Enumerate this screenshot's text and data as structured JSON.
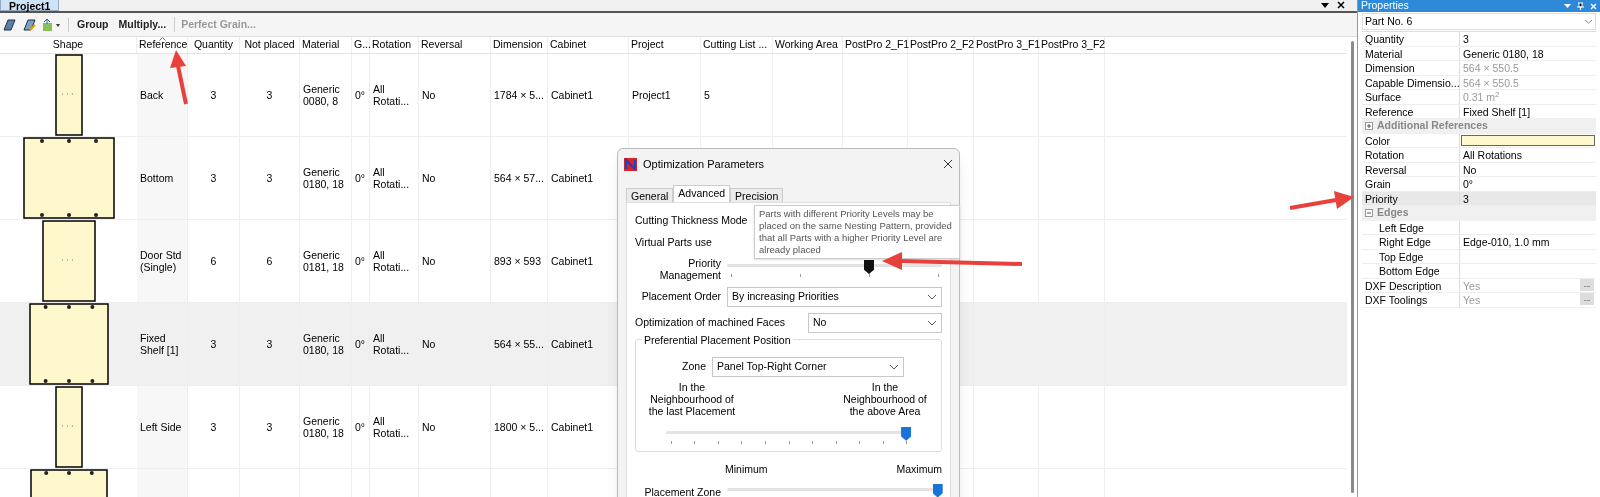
{
  "document_tab": {
    "label": "Project1",
    "selected": true
  },
  "toolbar": {
    "buttons": [
      {
        "label": "Group",
        "disabled": false
      },
      {
        "label": "Multiply...",
        "disabled": false
      },
      {
        "label": "Perfect Grain...",
        "disabled": true
      }
    ]
  },
  "table": {
    "shape_column": "Shape",
    "columns": [
      "Reference",
      "Quantity",
      "Not placed",
      "Material",
      "G...",
      "Rotation",
      "Reversal",
      "Dimension",
      "Cabinet",
      "Project",
      "Cutting List ...",
      "Working Area",
      "PostPro 2_F1",
      "PostPro 2_F2",
      "PostPro 3_F1",
      "PostPro 3_F2"
    ],
    "rows": [
      {
        "selected": false,
        "cells": [
          "Back",
          "3",
          "3",
          "Generic 0080, 8",
          "0°",
          "All Rotati...",
          "No",
          "1784 × 5...",
          "Cabinet1",
          "Project1",
          "5"
        ]
      },
      {
        "selected": false,
        "cells": [
          "Bottom",
          "3",
          "3",
          "Generic 0180, 18",
          "0°",
          "All Rotati...",
          "No",
          "564 × 57...",
          "Cabinet1"
        ]
      },
      {
        "selected": false,
        "cells": [
          "Door Std (Single)",
          "6",
          "6",
          "Generic 0181, 18",
          "0°",
          "All Rotati...",
          "No",
          "893 × 593",
          "Cabinet1"
        ]
      },
      {
        "selected": true,
        "cells": [
          "Fixed Shelf [1]",
          "3",
          "3",
          "Generic 0180, 18",
          "0°",
          "All Rotati...",
          "No",
          "564 × 55...",
          "Cabinet1"
        ]
      },
      {
        "selected": false,
        "cells": [
          "Left Side",
          "3",
          "3",
          "Generic 0180, 18",
          "0°",
          "All Rotati...",
          "No",
          "1800 × 5...",
          "Cabinet1"
        ]
      },
      {
        "selected": false
      }
    ]
  },
  "dialog": {
    "title": "Optimization Parameters",
    "tabs": [
      {
        "label": "General",
        "selected": false
      },
      {
        "label": "Advanced",
        "selected": true
      },
      {
        "label": "Precision",
        "selected": false
      }
    ],
    "labels": [
      "Cutting Thickness Mode",
      "Virtual Parts use"
    ],
    "priority": {
      "label": "Priority Management",
      "level": 0.667
    },
    "placement_order": {
      "label": "Placement Order",
      "value": "By increasing Priorities"
    },
    "machined_faces": {
      "label": "Optimization of machined Faces",
      "value": "No"
    },
    "group": {
      "title": "Preferential Placement Position",
      "zone_label": "Zone",
      "zone_value": "Panel Top-Right Corner",
      "left_label": "In the Neighbourhood of the last Placement",
      "right_label": "In the Neighbourhood of the above Area",
      "level": 1
    },
    "zone_adjust": {
      "min_label": "Minimum",
      "max_label": "Maximum",
      "label": "Placement Zone",
      "level": 1
    },
    "tooltip": "Parts with different Priority Levels may be placed on the same Nesting Pattern, provided that all Parts with a higher Priority Level are already placed"
  },
  "properties": {
    "title": "Properties",
    "selector": "Part No. 6",
    "rows": [
      {
        "kind": "row",
        "label": "Quantity",
        "value": "3",
        "dimmed": false,
        "selected": false
      },
      {
        "kind": "row",
        "label": "Material",
        "value": "Generic 0180, 18",
        "dimmed": false,
        "selected": false
      },
      {
        "kind": "row",
        "label": "Dimension",
        "value": "564 × 550.5",
        "dimmed": true,
        "selected": false
      },
      {
        "kind": "row",
        "label": "Capable Dimensio...",
        "value": "564 × 550.5",
        "dimmed": true,
        "selected": false
      },
      {
        "kind": "row",
        "label": "Surface",
        "value": "0.31 m$^{2}$",
        "dimmed": true,
        "selected": false
      },
      {
        "kind": "row",
        "label": "Reference",
        "value": "Fixed Shelf [1]",
        "dimmed": false,
        "selected": false
      },
      {
        "kind": "group",
        "label": "Additional References",
        "expanded": false,
        "children": []
      },
      {
        "kind": "color",
        "label": "Color",
        "color": "#fff8cc",
        "selected": false
      },
      {
        "kind": "row",
        "label": "Rotation",
        "value": "All Rotations",
        "dimmed": false,
        "selected": false
      },
      {
        "kind": "row",
        "label": "Reversal",
        "value": "No",
        "dimmed": false,
        "selected": false
      },
      {
        "kind": "row",
        "label": "Grain",
        "value": "0°",
        "dimmed": false,
        "selected": false
      },
      {
        "kind": "row",
        "label": "Priority",
        "value": "3",
        "dimmed": false,
        "selected": true
      },
      {
        "kind": "group",
        "label": "Edges",
        "expanded": true,
        "children": [
          {
            "label": "Left Edge",
            "selected": false
          },
          {
            "label": "Right Edge",
            "value": "Edge-010, 1.0 mm",
            "dimmed": false,
            "selected": false
          },
          {
            "label": "Top Edge",
            "selected": false
          },
          {
            "label": "Bottom Edge",
            "selected": false
          }
        ]
      },
      {
        "kind": "button",
        "label": "DXF Description",
        "value": "Yes",
        "button": "...",
        "dimmed": true,
        "selected": false
      },
      {
        "kind": "button",
        "label": "DXF Toolings",
        "value": "Yes",
        "button": "...",
        "dimmed": true,
        "selected": false
      }
    ]
  }
}
